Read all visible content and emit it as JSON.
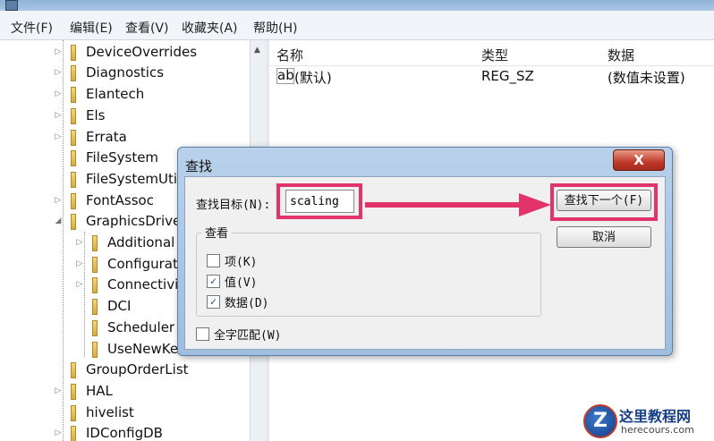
{
  "menu": [
    "文件(F)",
    "编辑(E)",
    "查看(V)",
    "收藏夹(A)",
    "帮助(H)"
  ],
  "tree": [
    {
      "label": "DeviceOverrides",
      "expander": "▷"
    },
    {
      "label": "Diagnostics",
      "expander": "▷"
    },
    {
      "label": "Elantech",
      "expander": "▷"
    },
    {
      "label": "Els",
      "expander": "▷"
    },
    {
      "label": "Errata",
      "expander": "▷"
    },
    {
      "label": "FileSystem",
      "expander": ""
    },
    {
      "label": "FileSystemUti",
      "expander": ""
    },
    {
      "label": "FontAssoc",
      "expander": "▷"
    },
    {
      "label": "GraphicsDrive",
      "expander": "◢"
    },
    {
      "label": "Additional",
      "expander": "▷"
    },
    {
      "label": "Configurati",
      "expander": "▷"
    },
    {
      "label": "Connectivi",
      "expander": "▷"
    },
    {
      "label": "DCI",
      "expander": ""
    },
    {
      "label": "Scheduler",
      "expander": ""
    },
    {
      "label": "UseNewKe",
      "expander": ""
    },
    {
      "label": "GroupOrderList",
      "expander": ""
    },
    {
      "label": "HAL",
      "expander": "▷"
    },
    {
      "label": "hivelist",
      "expander": ""
    },
    {
      "label": "IDConfigDB",
      "expander": "▷"
    }
  ],
  "list": {
    "headers": {
      "name": "名称",
      "type": "类型",
      "data": "数据"
    },
    "rows": [
      {
        "icon": "ab",
        "name": "(默认)",
        "type": "REG_SZ",
        "data": "(数值未设置)"
      }
    ]
  },
  "dialog": {
    "title": "查找",
    "close": "X",
    "find_label": "查找目标(N):",
    "find_value": "scaling",
    "find_next": "查找下一个(F)",
    "cancel": "取消",
    "group_title": "查看",
    "options": [
      {
        "label": "项(K)",
        "checked": false
      },
      {
        "label": "值(V)",
        "checked": true
      },
      {
        "label": "数据(D)",
        "checked": true
      }
    ],
    "whole_match": {
      "label": "全字匹配(W)",
      "checked": false
    }
  },
  "watermark": {
    "logo": "Z",
    "name": "这里教程网",
    "url": "herecours.com"
  },
  "colors": {
    "highlight": "#e2336a",
    "close_button": "#c0392b"
  }
}
